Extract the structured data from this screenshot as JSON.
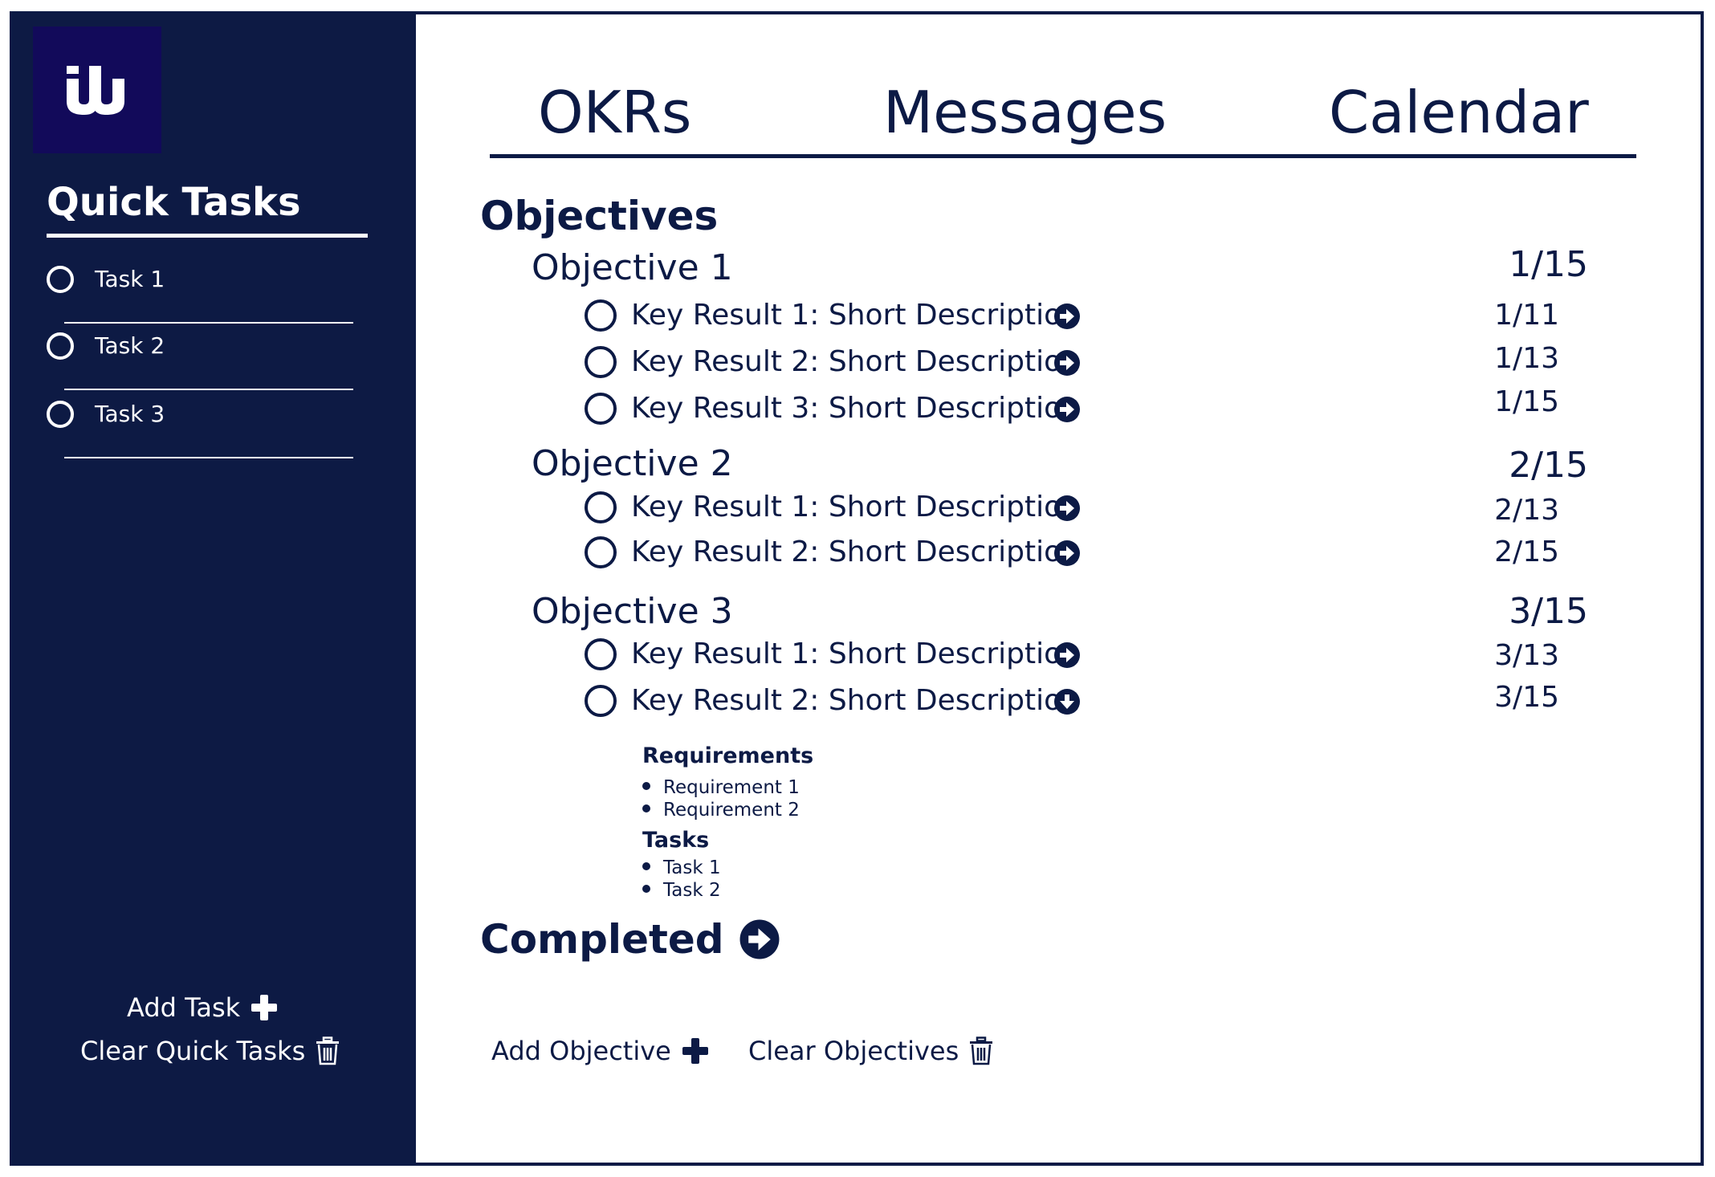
{
  "colors": {
    "navy": "#0d1a44",
    "logo_bg": "#120a5a",
    "white": "#ffffff"
  },
  "logo": {
    "letter": "w"
  },
  "sidebar": {
    "title": "Quick Tasks",
    "tasks": [
      {
        "label": "Task 1"
      },
      {
        "label": "Task 2"
      },
      {
        "label": "Task 3"
      }
    ],
    "add_task_label": "Add Task",
    "clear_label": "Clear Quick Tasks"
  },
  "tabs": [
    {
      "label": "OKRs"
    },
    {
      "label": "Messages"
    },
    {
      "label": "Calendar"
    }
  ],
  "objectives_title": "Objectives",
  "objectives": [
    {
      "title": "Objective 1",
      "date": "1/15",
      "key_results": [
        {
          "label": "Key Result 1: Short Description",
          "date": "1/11",
          "icon": "arrow-right-circle"
        },
        {
          "label": "Key Result 2: Short Description",
          "date": "1/13",
          "icon": "arrow-right-circle"
        },
        {
          "label": "Key Result 3: Short Description",
          "date": "1/15",
          "icon": "arrow-right-circle"
        }
      ]
    },
    {
      "title": "Objective 2",
      "date": "2/15",
      "key_results": [
        {
          "label": "Key Result 1: Short Description",
          "date": "2/13",
          "icon": "arrow-right-circle"
        },
        {
          "label": "Key Result 2: Short Description",
          "date": "2/15",
          "icon": "arrow-right-circle"
        }
      ]
    },
    {
      "title": "Objective 3",
      "date": "3/15",
      "key_results": [
        {
          "label": "Key Result 1: Short Description",
          "date": "3/13",
          "icon": "arrow-right-circle"
        },
        {
          "label": "Key Result 2: Short Description",
          "date": "3/15",
          "icon": "arrow-down-circle",
          "expanded": {
            "requirements_title": "Requirements",
            "requirements": [
              "Requirement 1",
              "Requirement 2"
            ],
            "tasks_title": "Tasks",
            "tasks": [
              "Task 1",
              "Task 2"
            ]
          }
        }
      ]
    }
  ],
  "completed_title": "Completed",
  "actions": {
    "add_objective": "Add Objective",
    "clear_objectives": "Clear Objectives"
  }
}
